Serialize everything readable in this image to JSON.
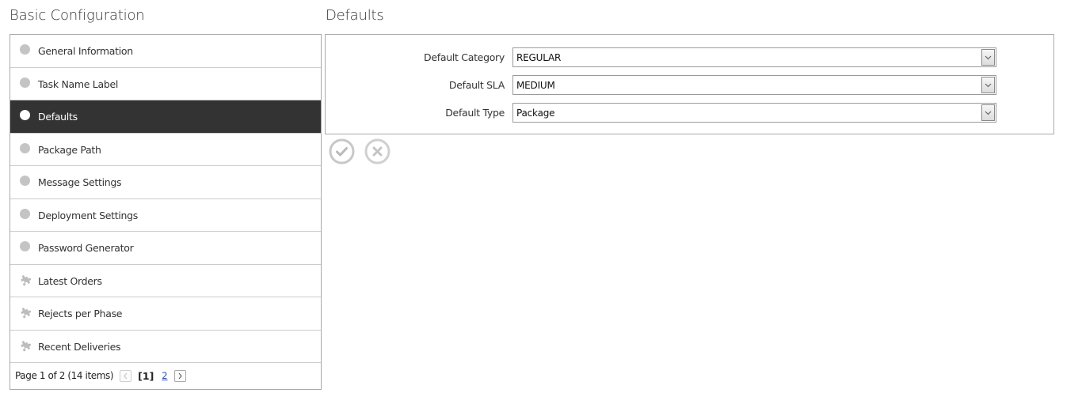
{
  "left_panel": {
    "title": "Basic Configuration",
    "items": [
      {
        "label": "General Information",
        "icon": "circle-icon",
        "active": false
      },
      {
        "label": "Task Name Label",
        "icon": "circle-icon",
        "active": false
      },
      {
        "label": "Defaults",
        "icon": "circle-icon",
        "active": true
      },
      {
        "label": "Package Path",
        "icon": "circle-icon",
        "active": false
      },
      {
        "label": "Message Settings",
        "icon": "circle-icon",
        "active": false
      },
      {
        "label": "Deployment Settings",
        "icon": "circle-icon",
        "active": false
      },
      {
        "label": "Password Generator",
        "icon": "circle-icon",
        "active": false
      },
      {
        "label": "Latest Orders",
        "icon": "puzzle-icon",
        "active": false
      },
      {
        "label": "Rejects per Phase",
        "icon": "puzzle-icon",
        "active": false
      },
      {
        "label": "Recent Deliveries",
        "icon": "puzzle-icon",
        "active": false
      }
    ],
    "pager": {
      "summary": "Page 1 of 2 (14 items)",
      "prev_symbol": "<",
      "current_page": "[1]",
      "other_page": "2",
      "next_symbol": ">"
    }
  },
  "right_panel": {
    "title": "Defaults",
    "fields": [
      {
        "label": "Default Category",
        "value": "REGULAR"
      },
      {
        "label": "Default SLA",
        "value": "MEDIUM"
      },
      {
        "label": "Default Type",
        "value": "Package"
      }
    ],
    "actions": {
      "save_icon": "check-circle-icon",
      "cancel_icon": "x-circle-icon"
    }
  },
  "colors": {
    "active_bg": "#333333",
    "border": "#aaaaaa",
    "icon_gray": "#c4c4c4",
    "link": "#2a4fa8"
  }
}
